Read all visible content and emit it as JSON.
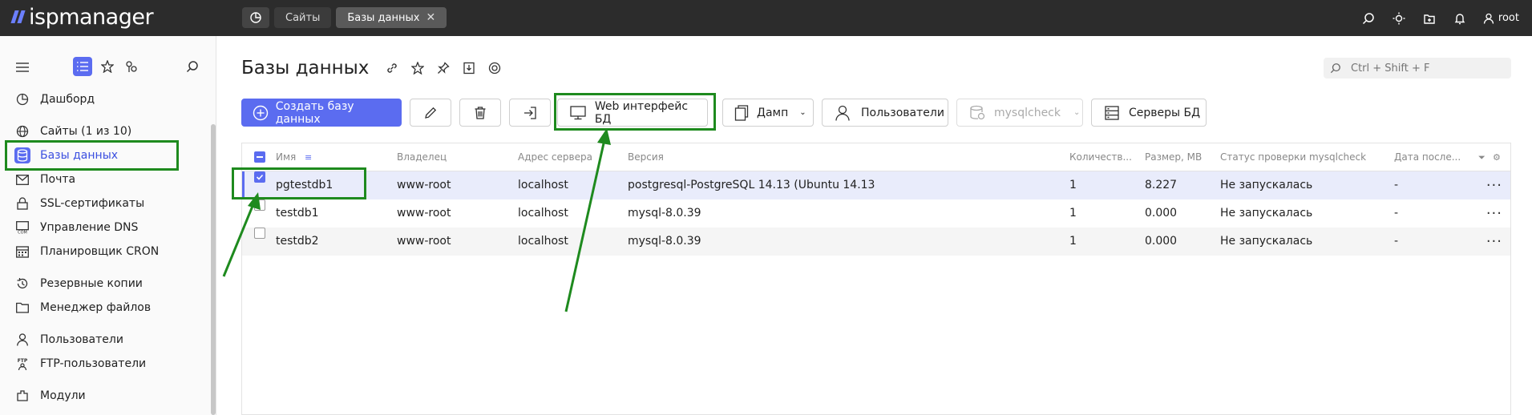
{
  "app": {
    "logo_text": "ispmanager"
  },
  "top_tabs": [
    {
      "label": "Сайты"
    },
    {
      "label": "Базы данных",
      "close": "✕"
    }
  ],
  "user": {
    "name": "root"
  },
  "sidebar": {
    "items": [
      {
        "label": "Дашборд",
        "icon": "dashboard-icon"
      },
      {
        "label": "Сайты (1 из 10)",
        "icon": "globe-icon"
      },
      {
        "label": "Базы данных",
        "icon": "database-icon"
      },
      {
        "label": "Почта",
        "icon": "mail-icon"
      },
      {
        "label": "SSL-сертификаты",
        "icon": "lock-icon"
      },
      {
        "label": "Управление DNS",
        "icon": "dns-icon"
      },
      {
        "label": "Планировщик CRON",
        "icon": "calendar-icon"
      },
      {
        "label": "Резервные копии",
        "icon": "backup-icon"
      },
      {
        "label": "Менеджер файлов",
        "icon": "folder-icon"
      },
      {
        "label": "Пользователи",
        "icon": "user-icon"
      },
      {
        "label": "FTP-пользователи",
        "icon": "ftp-icon"
      },
      {
        "label": "Модули",
        "icon": "modules-icon"
      }
    ]
  },
  "page": {
    "title": "Базы данных"
  },
  "search": {
    "placeholder": "Ctrl + Shift + F"
  },
  "toolbar": {
    "create": "Создать базу данных",
    "web": "Web интерфейс БД",
    "dump": "Дамп",
    "users": "Пользователи",
    "mysqlcheck": "mysqlcheck",
    "servers": "Серверы БД"
  },
  "table": {
    "columns": [
      "Имя",
      "Владелец",
      "Адрес сервера",
      "Версия",
      "Количеств...",
      "Размер, MB",
      "Статус проверки mysqlcheck",
      "Дата после..."
    ],
    "rows": [
      {
        "name": "pgtestdb1",
        "owner": "www-root",
        "server": "localhost",
        "version": "postgresql-PostgreSQL 14.13 (Ubuntu 14.13",
        "count": "1",
        "size": "8.227",
        "status": "Не запускалась",
        "date": "-",
        "checked": true
      },
      {
        "name": "testdb1",
        "owner": "www-root",
        "server": "localhost",
        "version": "mysql-8.0.39",
        "count": "1",
        "size": "0.000",
        "status": "Не запускалась",
        "date": "-",
        "checked": false
      },
      {
        "name": "testdb2",
        "owner": "www-root",
        "server": "localhost",
        "version": "mysql-8.0.39",
        "count": "1",
        "size": "0.000",
        "status": "Не запускалась",
        "date": "-",
        "checked": false
      }
    ]
  },
  "colors": {
    "accent": "#5b6cf0",
    "highlight": "#1e8a1e",
    "topbar": "#2c2c2c"
  }
}
